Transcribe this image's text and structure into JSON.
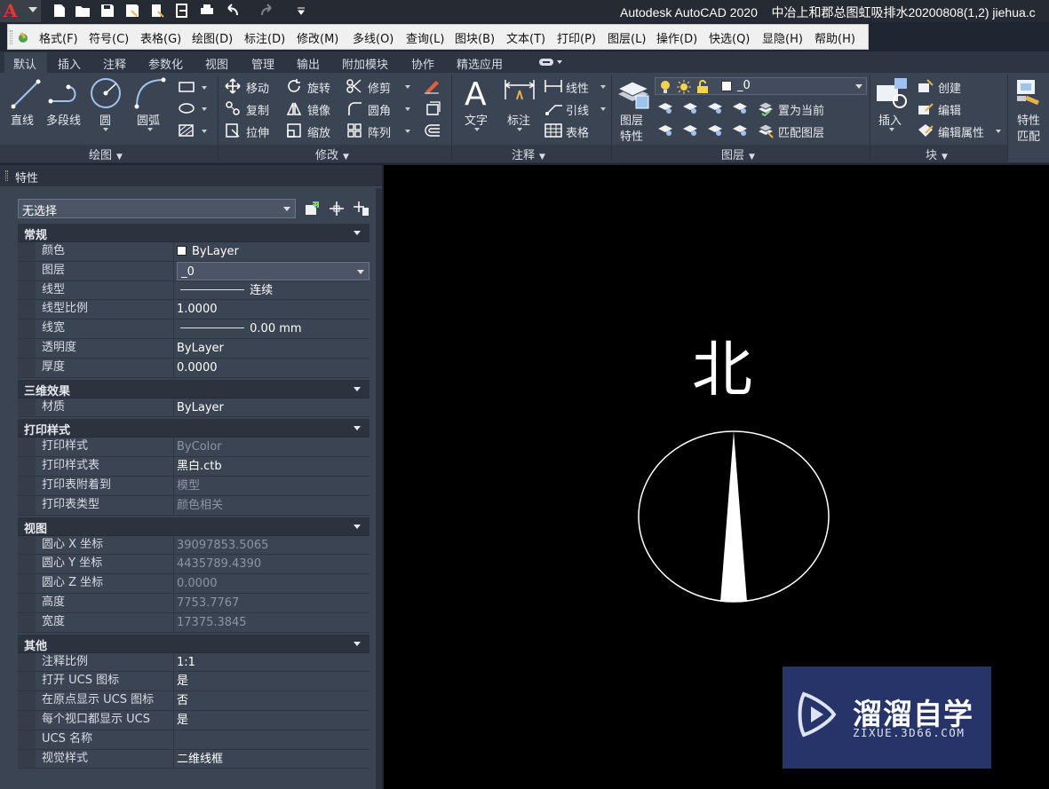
{
  "titlebar": {
    "app_title": "Autodesk AutoCAD 2020",
    "document_title": "中冶上和郡总图虹吸排水20200808(1,2) jiehua.c",
    "logo_letter": "A"
  },
  "menubar": {
    "items": [
      "格式(F)",
      "符号(C)",
      "表格(G)",
      "绘图(D)",
      "标注(D)",
      "修改(M)",
      "多线(O)",
      "查询(L)",
      "图块(B)",
      "文本(T)",
      "打印(P)",
      "图层(L)",
      "操作(D)",
      "快选(Q)",
      "显隐(H)",
      "帮助(H)"
    ]
  },
  "ribbon_tabs": [
    "默认",
    "插入",
    "注释",
    "参数化",
    "视图",
    "管理",
    "输出",
    "附加模块",
    "协作",
    "精选应用"
  ],
  "ribbon": {
    "draw": {
      "title": "绘图",
      "line": "直线",
      "polyline": "多段线",
      "circle": "圆",
      "arc": "圆弧"
    },
    "modify": {
      "title": "修改",
      "move": "移动",
      "rotate": "旋转",
      "trim": "修剪",
      "copy": "复制",
      "mirror": "镜像",
      "fillet": "圆角",
      "stretch": "拉伸",
      "scale": "缩放",
      "array": "阵列"
    },
    "annotation": {
      "title": "注释",
      "text": "文字",
      "dimension": "标注",
      "linear": "线性",
      "leader": "引线",
      "table": "表格"
    },
    "layers": {
      "title": "图层",
      "layer_props_1": "图层",
      "layer_props_2": "特性",
      "current_layer": "_0",
      "set_current": "置为当前",
      "match_layer": "匹配图层"
    },
    "block": {
      "title": "块",
      "insert": "插入",
      "create": "创建",
      "edit": "编辑",
      "edit_attributes": "编辑属性"
    },
    "properties": {
      "match_1": "特性",
      "match_2": "匹配"
    }
  },
  "properties_palette": {
    "title": "特性",
    "selection": "无选择",
    "categories": [
      {
        "name": "常规",
        "rows": [
          {
            "label": "颜色",
            "value": "ByLayer",
            "type": "color"
          },
          {
            "label": "图层",
            "value": "_0",
            "type": "select"
          },
          {
            "label": "线型",
            "value": "连续",
            "type": "line"
          },
          {
            "label": "线型比例",
            "value": "1.0000"
          },
          {
            "label": "线宽",
            "value": "0.00 mm",
            "type": "line"
          },
          {
            "label": "透明度",
            "value": "ByLayer"
          },
          {
            "label": "厚度",
            "value": "0.0000"
          }
        ]
      },
      {
        "name": "三维效果",
        "rows": [
          {
            "label": "材质",
            "value": "ByLayer"
          }
        ]
      },
      {
        "name": "打印样式",
        "rows": [
          {
            "label": "打印样式",
            "value": "ByColor",
            "dim": true
          },
          {
            "label": "打印样式表",
            "value": "黑白.ctb"
          },
          {
            "label": "打印表附着到",
            "value": "模型",
            "dim": true
          },
          {
            "label": "打印表类型",
            "value": "颜色相关",
            "dim": true
          }
        ]
      },
      {
        "name": "视图",
        "rows": [
          {
            "label": "圆心 X 坐标",
            "value": "39097853.5065",
            "dim": true
          },
          {
            "label": "圆心 Y 坐标",
            "value": "4435789.4390",
            "dim": true
          },
          {
            "label": "圆心 Z 坐标",
            "value": "0.0000",
            "dim": true
          },
          {
            "label": "高度",
            "value": "7753.7767",
            "dim": true
          },
          {
            "label": "宽度",
            "value": "17375.3845",
            "dim": true
          }
        ]
      },
      {
        "name": "其他",
        "rows": [
          {
            "label": "注释比例",
            "value": "1:1"
          },
          {
            "label": "打开 UCS 图标",
            "value": "是"
          },
          {
            "label": "在原点显示 UCS 图标",
            "value": "否"
          },
          {
            "label": "每个视口都显示 UCS",
            "value": "是"
          },
          {
            "label": "UCS 名称",
            "value": ""
          },
          {
            "label": "视觉样式",
            "value": "二维线框"
          }
        ]
      }
    ]
  },
  "drawing": {
    "north_label": "北"
  },
  "watermark": {
    "title": "溜溜自学",
    "subtitle": "ZIXUE.3D66.COM"
  },
  "colors": {
    "titlebar": "#252a33",
    "ribbon": "#3b4453",
    "canvas": "#000000",
    "watermark": "#26346a",
    "logo_red": "#e03a2e"
  }
}
